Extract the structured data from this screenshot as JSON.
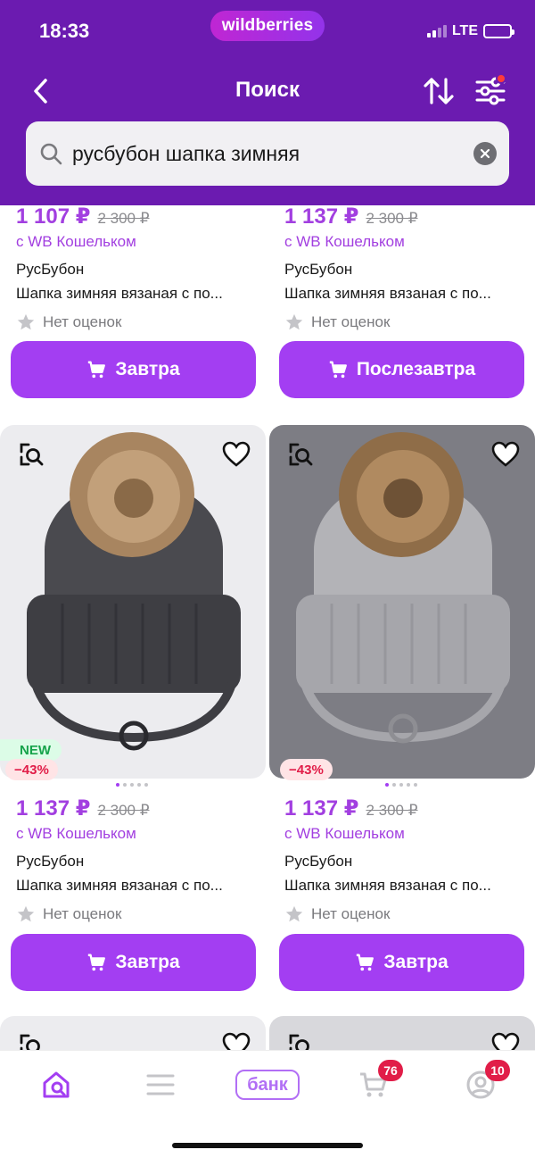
{
  "status_bar": {
    "time": "18:33",
    "network": "LTE"
  },
  "brand_pill": "wildberries",
  "header": {
    "title": "Поиск"
  },
  "search": {
    "value": "русбубон шапка зимняя"
  },
  "products": [
    {
      "price": "1 107 ₽",
      "old_price": "2 300 ₽",
      "wallet": "с WB Кошельком",
      "brand": "РусБубон",
      "title": "Шапка зимняя вязаная с по...",
      "rating": "Нет оценок",
      "delivery": "Завтра"
    },
    {
      "price": "1 137 ₽",
      "old_price": "2 300 ₽",
      "wallet": "с WB Кошельком",
      "brand": "РусБубон",
      "title": "Шапка зимняя вязаная с по...",
      "rating": "Нет оценок",
      "delivery": "Послезавтра"
    },
    {
      "price": "1 137 ₽",
      "old_price": "2 300 ₽",
      "wallet": "с WB Кошельком",
      "brand": "РусБубон",
      "title": "Шапка зимняя вязаная с по...",
      "rating": "Нет оценок",
      "delivery": "Завтра",
      "badge_new": "NEW",
      "discount": "−43%",
      "hat_color": "#4a4a4f"
    },
    {
      "price": "1 137 ₽",
      "old_price": "2 300 ₽",
      "wallet": "с WB Кошельком",
      "brand": "РусБубон",
      "title": "Шапка зимняя вязаная с по...",
      "rating": "Нет оценок",
      "delivery": "Завтра",
      "discount": "−43%",
      "hat_color": "#b3b3b7"
    }
  ],
  "tabbar": {
    "bank_label": "банк",
    "cart_count": "76",
    "profile_count": "10"
  },
  "colors": {
    "header": "#6b1bb0",
    "accent": "#a33ef2",
    "price": "#a23fe0"
  }
}
